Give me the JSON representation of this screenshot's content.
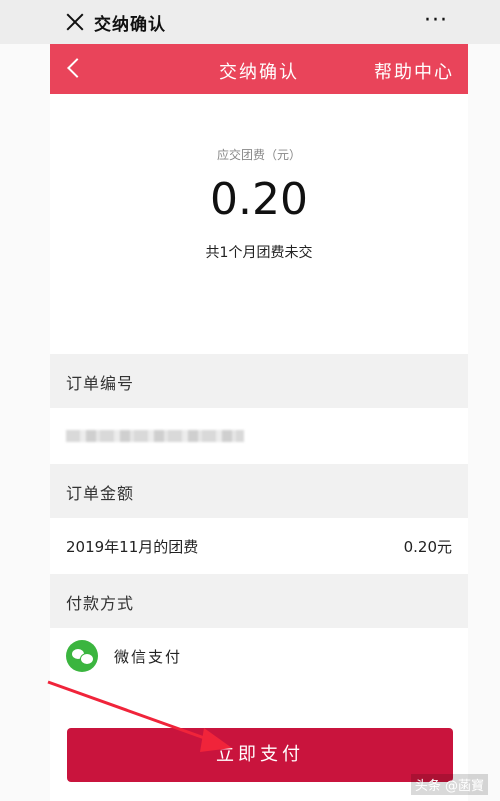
{
  "wechat_bar": {
    "title": "交纳确认",
    "more_label": "···"
  },
  "header": {
    "title": "交纳确认",
    "help_label": "帮助中心"
  },
  "amount": {
    "caption": "应交团费（元）",
    "value": "0.20",
    "note": "共1个月团费未交"
  },
  "order_number": {
    "heading": "订单编号"
  },
  "order_amount": {
    "heading": "订单金额",
    "item_label": "2019年11月的团费",
    "item_value": "0.20元"
  },
  "payment_method": {
    "heading": "付款方式",
    "option_label": "微信支付",
    "icon": "wechat-pay-icon"
  },
  "pay_button": {
    "label": "立即支付"
  },
  "watermark": {
    "text": "头条 @菡寶"
  },
  "colors": {
    "header_red": "#e9445a",
    "button_red": "#c9143d",
    "wechat_green": "#3bb53f"
  }
}
